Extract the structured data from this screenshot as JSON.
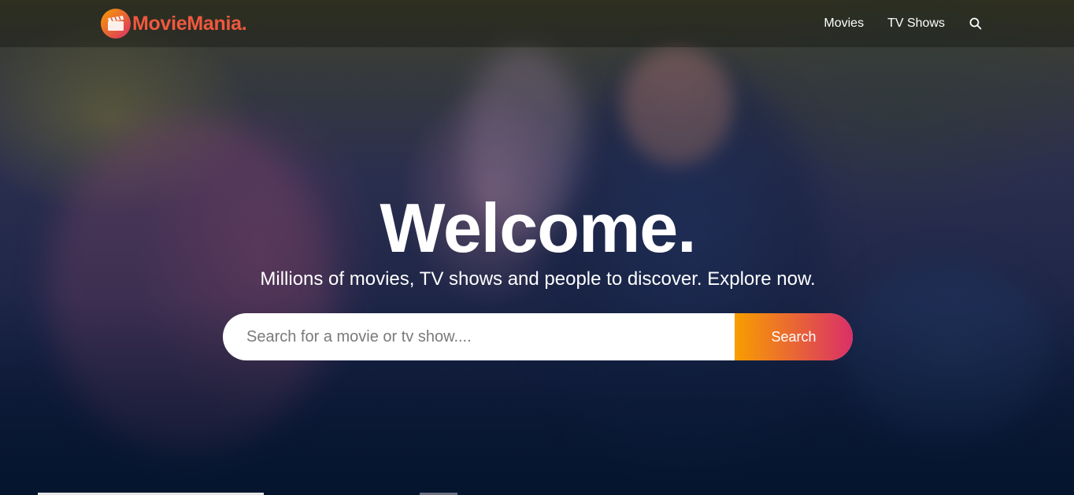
{
  "brand": {
    "name": "MovieMania.",
    "accent": "#f0583e",
    "gradient_start": "#f89e00",
    "gradient_end": "#da2f68"
  },
  "nav": {
    "items": [
      {
        "label": "Movies"
      },
      {
        "label": "TV Shows"
      }
    ],
    "search_icon": "search-icon"
  },
  "hero": {
    "title": "Welcome.",
    "subtitle": "Millions of movies, TV shows and people to discover. Explore now.",
    "search": {
      "placeholder": "Search for a movie or tv show....",
      "value": "",
      "button_label": "Search"
    }
  }
}
